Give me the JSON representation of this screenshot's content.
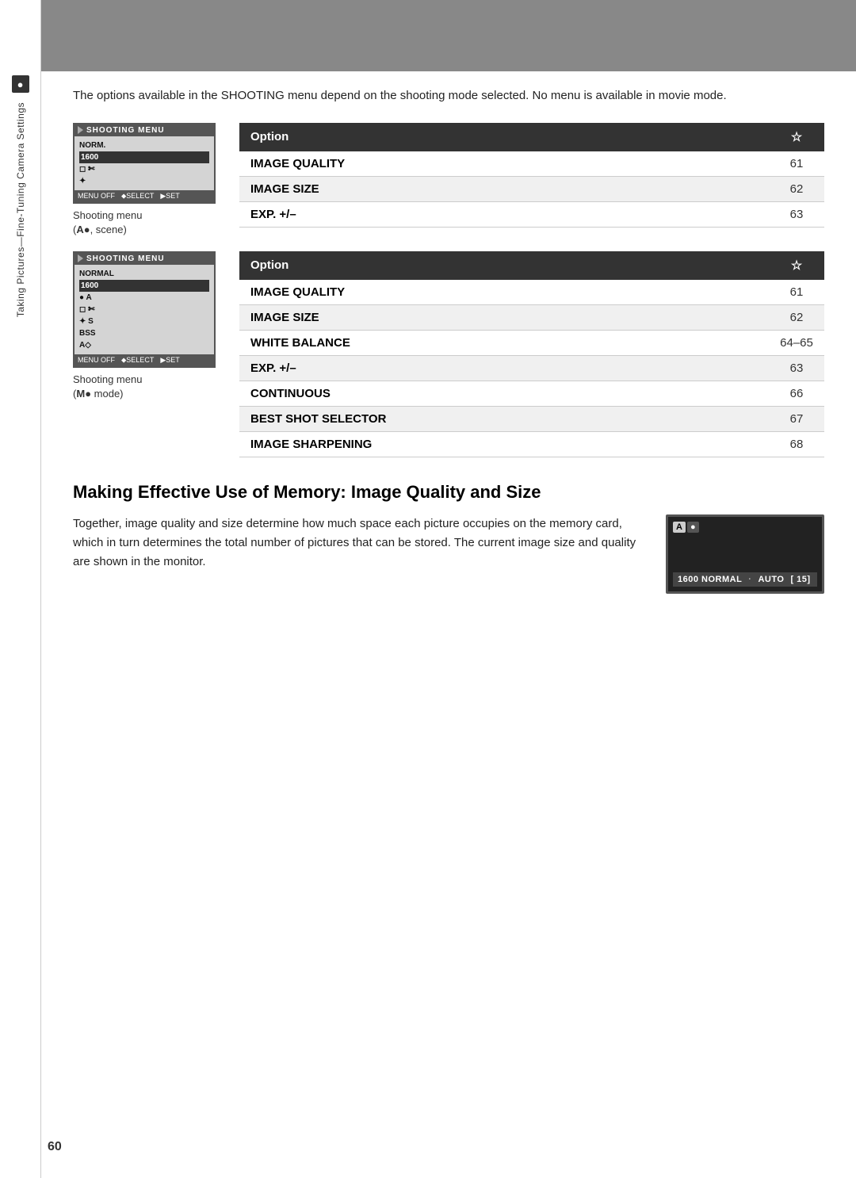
{
  "page": {
    "number": "60"
  },
  "sidebar": {
    "icon": "●",
    "text": "Taking Pictures—Fine-Tuning Camera Settings"
  },
  "intro": {
    "text": "The options available in the SHOOTING menu depend on the shooting mode selected.  No menu is available in movie mode."
  },
  "section1": {
    "screen": {
      "title": "SHOOTING MENU",
      "rows": [
        {
          "label": "NORM.",
          "selected": false
        },
        {
          "label": "1600",
          "selected": false
        },
        {
          "label": "◻ ✄",
          "selected": false
        },
        {
          "label": "✦",
          "selected": false
        }
      ],
      "footer": [
        "MENU OFF",
        "⬥SELECT",
        "▶SET"
      ]
    },
    "caption_line1": "Shooting menu",
    "caption_line2": "( A ●, scene)",
    "table": {
      "col1_header": "Option",
      "col2_header": "☆",
      "rows": [
        {
          "label": "IMAGE QUALITY",
          "page": "61"
        },
        {
          "label": "IMAGE SIZE",
          "page": "62"
        },
        {
          "label": "EXP. +/–",
          "page": "63"
        }
      ]
    }
  },
  "section2": {
    "screen": {
      "title": "SHOOTING MENU",
      "rows": [
        {
          "label": "NORMAL",
          "selected": false
        },
        {
          "label": "1600",
          "selected": false
        },
        {
          "label": "● A",
          "selected": false
        },
        {
          "label": "◻ ✄",
          "selected": false
        },
        {
          "label": "✦ S",
          "selected": false
        },
        {
          "label": "BSS",
          "selected": false
        },
        {
          "label": "A◇",
          "selected": false
        }
      ],
      "footer": [
        "MENU OFF",
        "⬥SELECT",
        "▶SET"
      ]
    },
    "caption_line1": "Shooting menu",
    "caption_line2": "( M ● mode)",
    "table": {
      "col1_header": "Option",
      "col2_header": "☆",
      "rows": [
        {
          "label": "IMAGE QUALITY",
          "page": "61"
        },
        {
          "label": "IMAGE SIZE",
          "page": "62"
        },
        {
          "label": "WHITE BALANCE",
          "page": "64–65"
        },
        {
          "label": "EXP. +/–",
          "page": "63"
        },
        {
          "label": "CONTINUOUS",
          "page": "66"
        },
        {
          "label": "BEST SHOT SELECTOR",
          "page": "67"
        },
        {
          "label": "IMAGE SHARPENING",
          "page": "68"
        }
      ]
    }
  },
  "making_section": {
    "heading": "Making Effective Use of Memory: Image Quality and Size",
    "body": "Together, image quality and size determine how much space each picture occupies on the memory card, which in turn determines the total number of pictures that can be stored.  The current image size and quality are shown in the monitor.",
    "monitor": {
      "top_icons": [
        "A",
        "●"
      ],
      "bottom_bar": [
        "1600 NORMAL",
        "AUTO",
        "[ 15]"
      ]
    }
  }
}
